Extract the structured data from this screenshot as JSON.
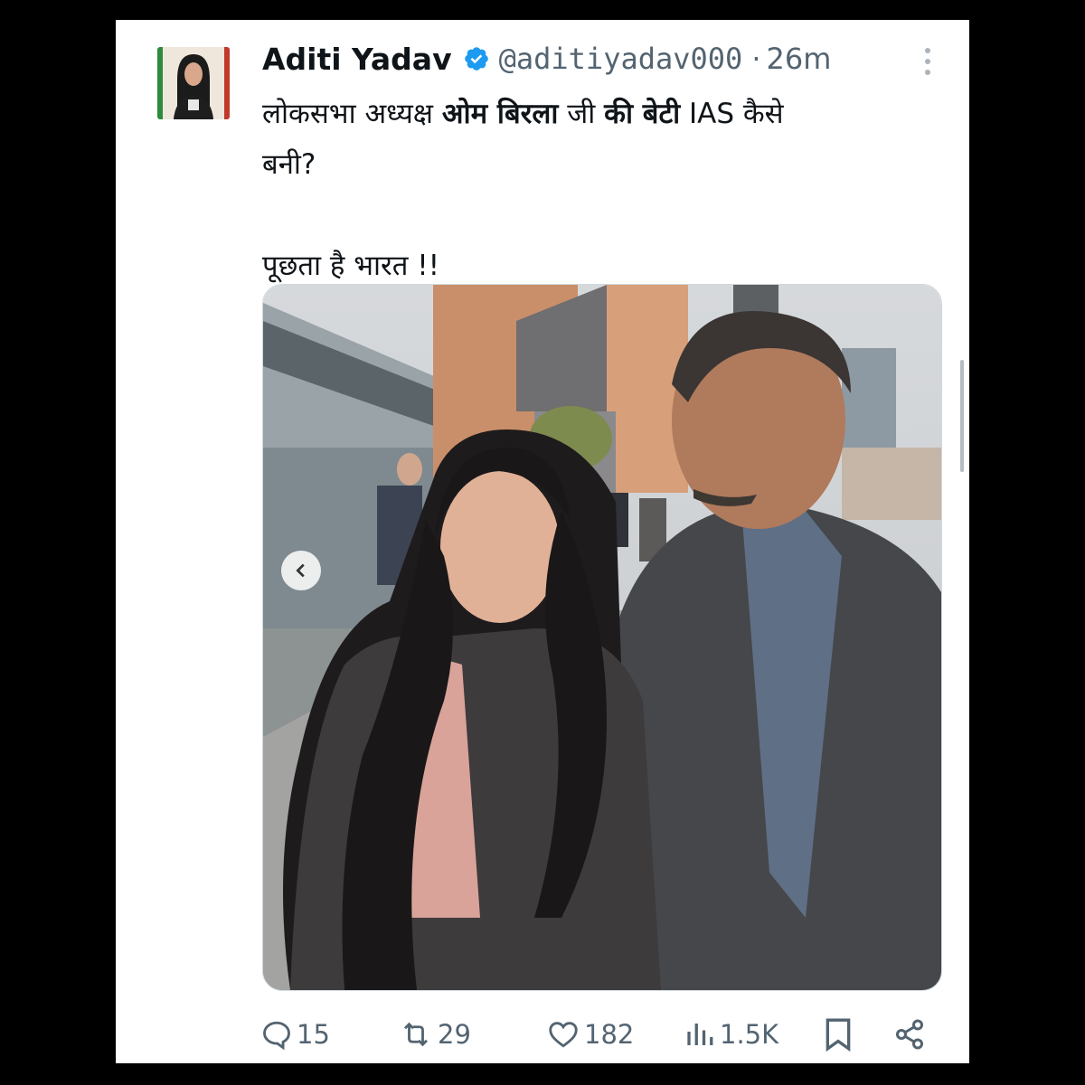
{
  "tweet": {
    "author_name": "Aditi Yadav",
    "handle": "@aditiyadav000",
    "separator": "·",
    "time": "26m",
    "text_line1_part1": "लोकसभा अध्यक्ष ",
    "text_line1_bold1": "ओम बिरला",
    "text_line1_part2": " जी ",
    "text_line1_bold2": "की बेटी",
    "text_line1_part3": " IAS कैसे",
    "text_line2": "बनी?",
    "text_line3": "पूछता है भारत !!"
  },
  "actions": {
    "replies": "15",
    "reposts": "29",
    "likes": "182",
    "views": "1.5K"
  },
  "icons": {
    "verified": "verified-badge-icon",
    "more": "more-options-icon",
    "reply": "reply-icon",
    "repost": "repost-icon",
    "like": "heart-icon",
    "views": "views-chart-icon",
    "bookmark": "bookmark-icon",
    "share": "share-icon",
    "prev": "chevron-left-icon"
  },
  "colors": {
    "verified_blue": "#1d9bf0",
    "text": "#0f1419",
    "secondary": "#536471"
  }
}
